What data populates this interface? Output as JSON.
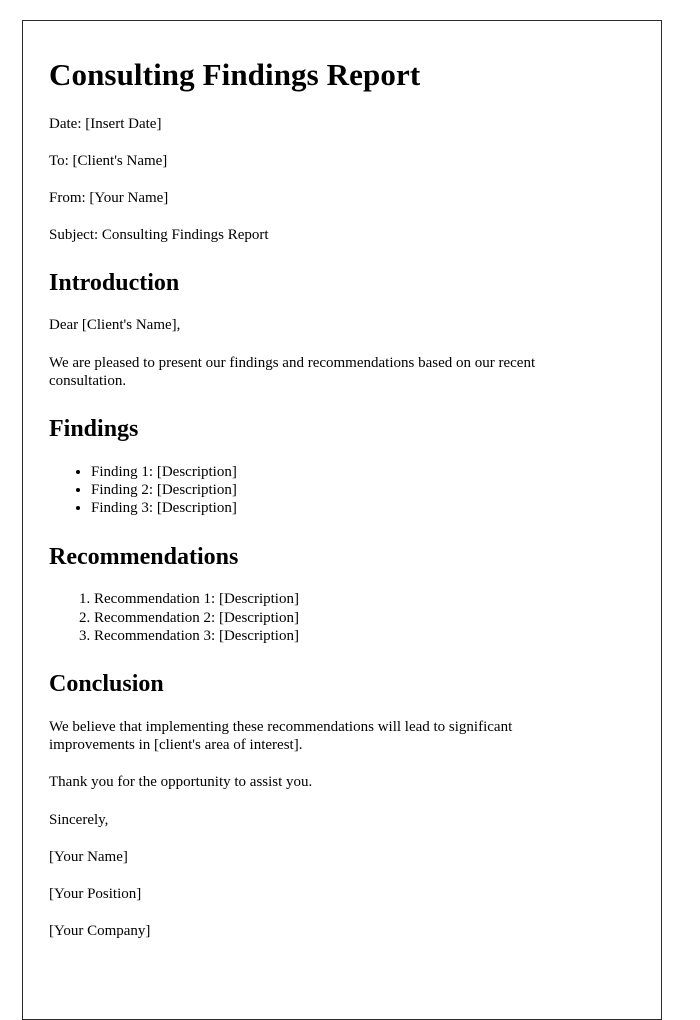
{
  "document": {
    "title": "Consulting Findings Report",
    "meta": [
      {
        "label": "Date",
        "text": "Date: [Insert Date]"
      },
      {
        "label": "To",
        "text": "To: [Client's Name]"
      },
      {
        "label": "From",
        "text": "From: [Your Name]"
      },
      {
        "label": "Subject",
        "text": "Subject: Consulting Findings Report"
      }
    ],
    "introduction": {
      "heading": "Introduction",
      "salutation": "Dear [Client's Name],",
      "paragraph": "We are pleased to present our findings and recommendations based on our recent consultation."
    },
    "findings": {
      "heading": "Findings",
      "items": [
        "Finding 1: [Description]",
        "Finding 2: [Description]",
        "Finding 3: [Description]"
      ]
    },
    "recommendations": {
      "heading": "Recommendations",
      "items": [
        "Recommendation 1: [Description]",
        "Recommendation 2: [Description]",
        "Recommendation 3: [Description]"
      ]
    },
    "conclusion": {
      "heading": "Conclusion",
      "paragraph": "We believe that implementing these recommendations will lead to significant improvements in [client's area of interest].",
      "thanks": "Thank you for the opportunity to assist you."
    },
    "signature": {
      "closing": "Sincerely,",
      "name": "[Your Name]",
      "position": "[Your Position]",
      "company": "[Your Company]"
    }
  }
}
